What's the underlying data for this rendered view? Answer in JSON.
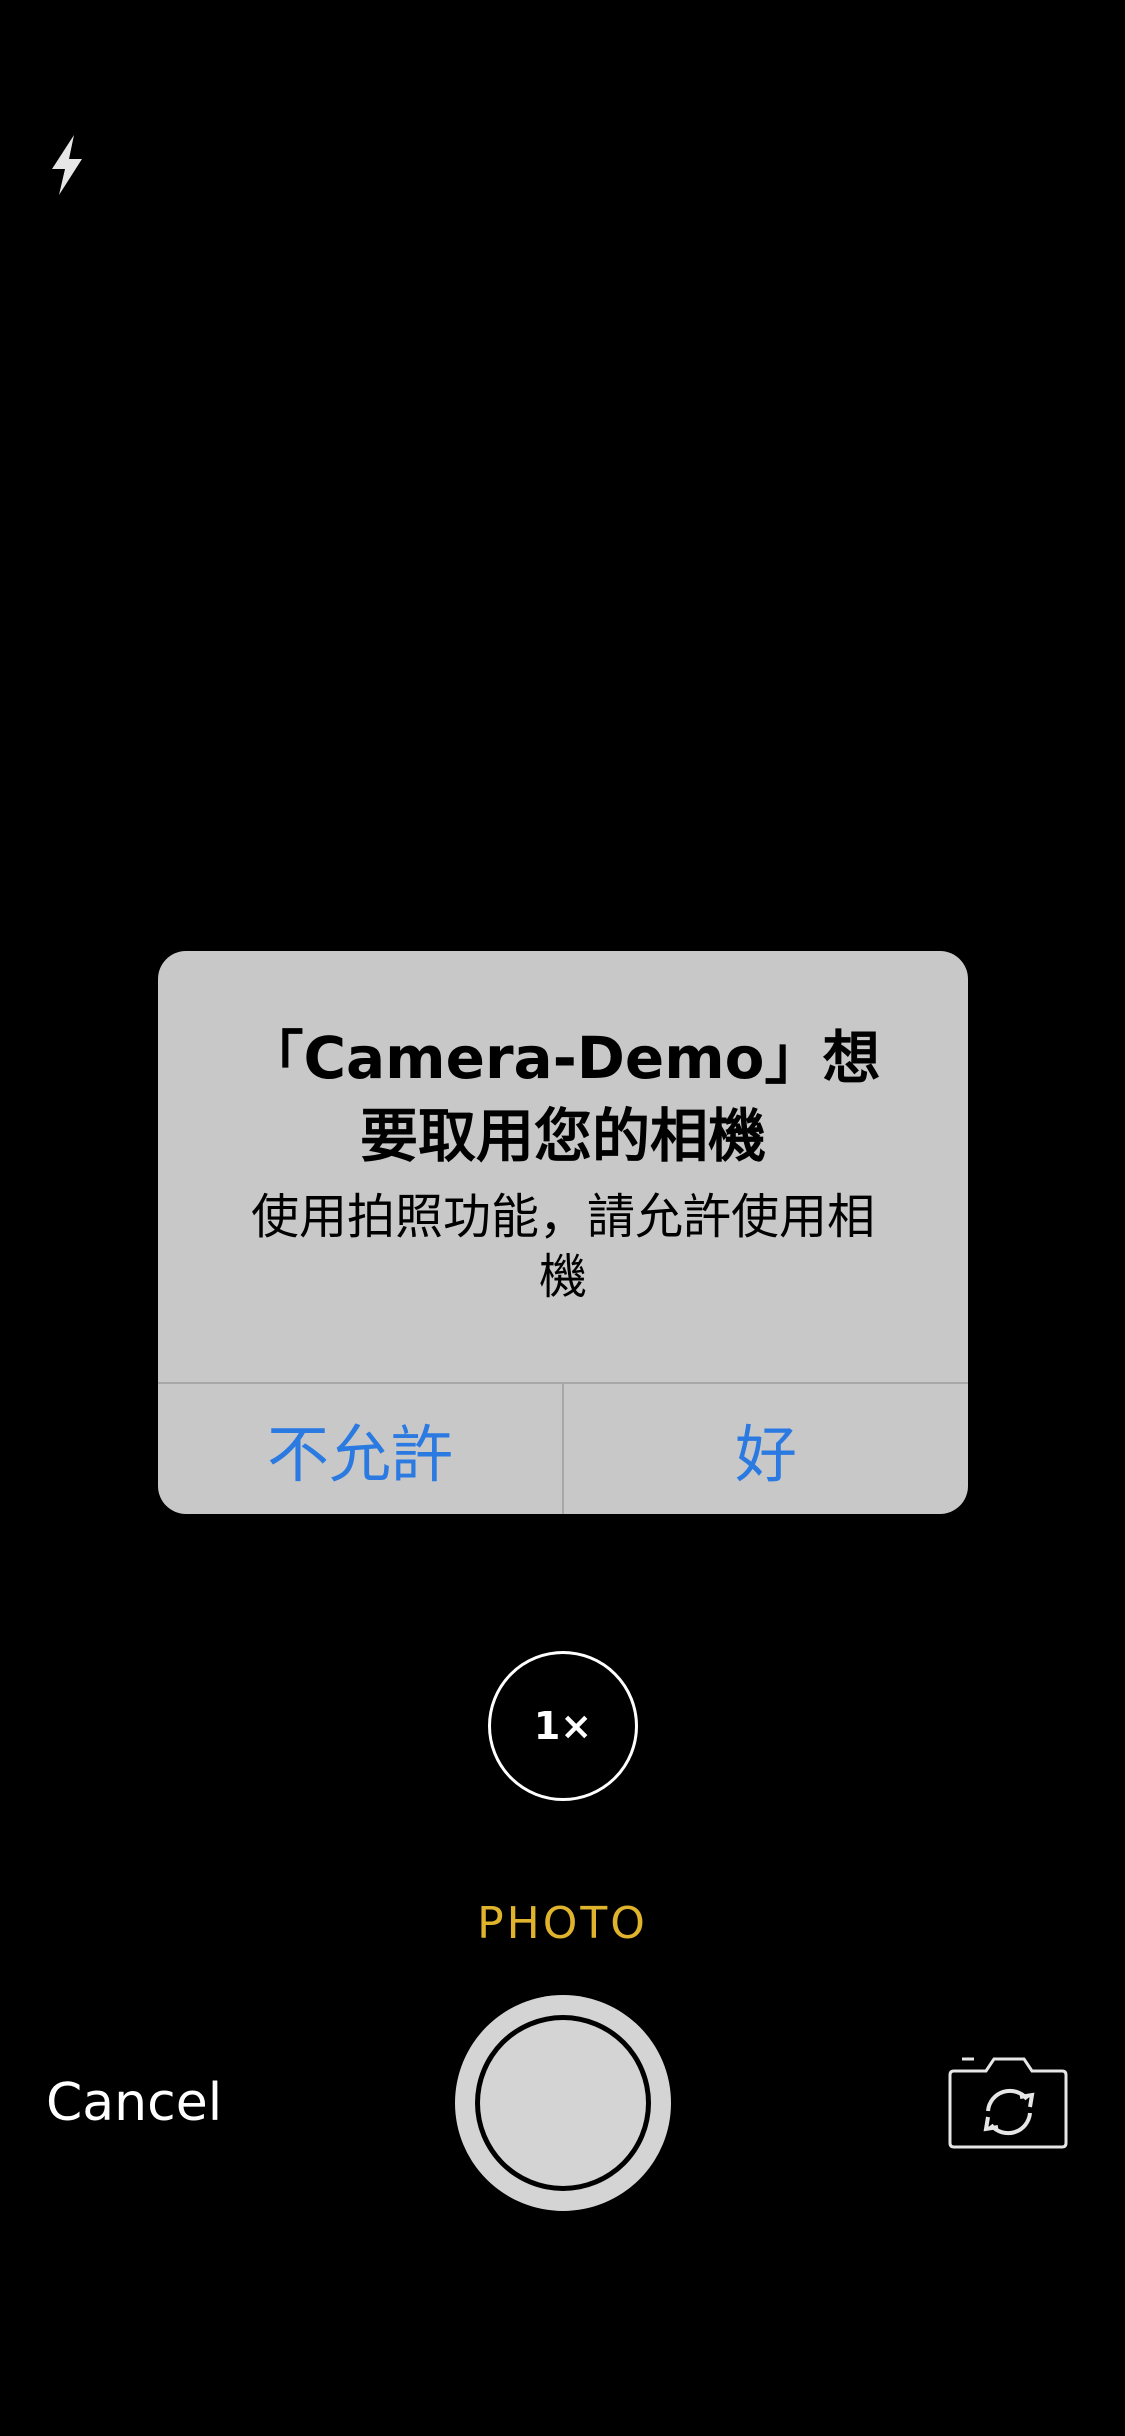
{
  "camera": {
    "flash_icon": "flash-icon",
    "zoom_label": "1×",
    "mode_label": "PHOTO",
    "cancel_label": "Cancel",
    "flip_icon": "camera-flip-icon"
  },
  "alert": {
    "title": "「Camera-Demo」想要取用您的相機",
    "message": "使用拍照功能，請允許使用相機",
    "deny_label": "不允許",
    "allow_label": "好"
  },
  "colors": {
    "background": "#000000",
    "alert_background": "#c8c8c8",
    "alert_button": "#2a7ae2",
    "mode_active": "#e0b32d",
    "text_light": "#ffffff"
  }
}
